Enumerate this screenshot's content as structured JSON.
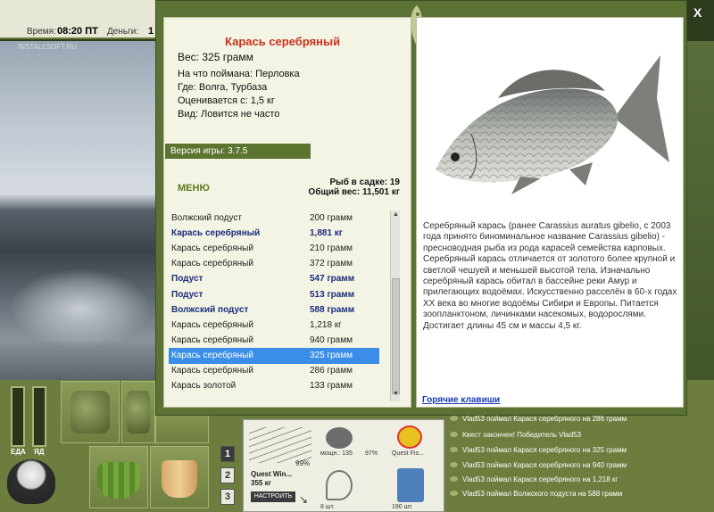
{
  "topbar": {
    "time_label": "Время:",
    "time_value": "08:20 ПТ",
    "money_label": "Деньги:",
    "money_value": "1",
    "logo": "INSTALLSOFT.RU"
  },
  "fish": {
    "title": "Карась серебряный",
    "weight": "Вес: 325 грамм",
    "bait": "На что поймана: Перловка",
    "place": "Где: Волга, Турбаза",
    "estimate": "Оценивается с: 1,5 кг",
    "kind": "Вид: Ловится не часто",
    "description": "Серебряный карась (ранее Carassius auratus gibelio, с 2003 года принято биноминальное название Carassius gibelio) - пресноводная рыба из рода карасей семейства карповых. Серебряный карась отличается от золотого более крупной и светлой чешуей и меньшей высотой тела. Изначально серебряный карась обитал в бассейне реки Амур и прилегающих водоёмах. Искусственно расселён в 60-х годах XX века во многие водоёмы Сибири и Европы. Питается зоопланктоном, личинками насекомых, водорослями. Достигает длины 45 см и массы 4,5 кг."
  },
  "version": "Версия игры: 3.7.5",
  "menu": "МЕНЮ",
  "keepnet": {
    "count": "Рыб в садке: 19",
    "total": "Общий вес: 11,501 кг"
  },
  "catch_list": [
    {
      "name": "Волжский подуст",
      "weight": "200 грамм",
      "bold": false,
      "selected": false
    },
    {
      "name": "Карась серебряный",
      "weight": "1,881 кг",
      "bold": true,
      "selected": false
    },
    {
      "name": "Карась серебряный",
      "weight": "210 грамм",
      "bold": false,
      "selected": false
    },
    {
      "name": "Карась серебряный",
      "weight": "372 грамм",
      "bold": false,
      "selected": false
    },
    {
      "name": "Подуст",
      "weight": "547 грамм",
      "bold": true,
      "selected": false
    },
    {
      "name": "Подуст",
      "weight": "513 грамм",
      "bold": true,
      "selected": false
    },
    {
      "name": "Волжский подуст",
      "weight": "588 грамм",
      "bold": true,
      "selected": false
    },
    {
      "name": "Карась серебряный",
      "weight": "1,218 кг",
      "bold": false,
      "selected": false
    },
    {
      "name": "Карась серебряный",
      "weight": "940 грамм",
      "bold": false,
      "selected": false
    },
    {
      "name": "Карась серебряный",
      "weight": "325 грамм",
      "bold": false,
      "selected": true
    },
    {
      "name": "Карась серебряный",
      "weight": "286 грамм",
      "bold": false,
      "selected": false
    },
    {
      "name": "Карась золотой",
      "weight": "133 грамм",
      "bold": false,
      "selected": false
    }
  ],
  "hotkeys": "Горячие клавиши",
  "close": "X",
  "gauges": {
    "food_label": "ЕДА",
    "sleep_label": "ЯД"
  },
  "tabs": [
    "1",
    "2",
    "3"
  ],
  "rod": {
    "percent": "99%",
    "name": "Quest Win...",
    "weight": "355 кг",
    "setup": "НАСТРОИТЬ"
  },
  "reel": {
    "label": "мощн.: 135",
    "percent": "97%"
  },
  "line": {
    "label": "Quest Fis..."
  },
  "hook": {
    "count": "8 шт."
  },
  "bait_box": {
    "count": "190 шт."
  },
  "chat": [
    "Vlad53 поймал Карася серебряного на 286 грамм",
    "Квест закончен! Победитель Vlad53",
    "Vlad53 поймал Карася серебряного на 325 грамм",
    "Vlad53 поймал Карася серебряного на 940 грамм",
    "Vlad53 поймал Карася серебряного на 1,218 кг",
    "Vlad53 поймал Волжского подуста на 588 грамм"
  ]
}
